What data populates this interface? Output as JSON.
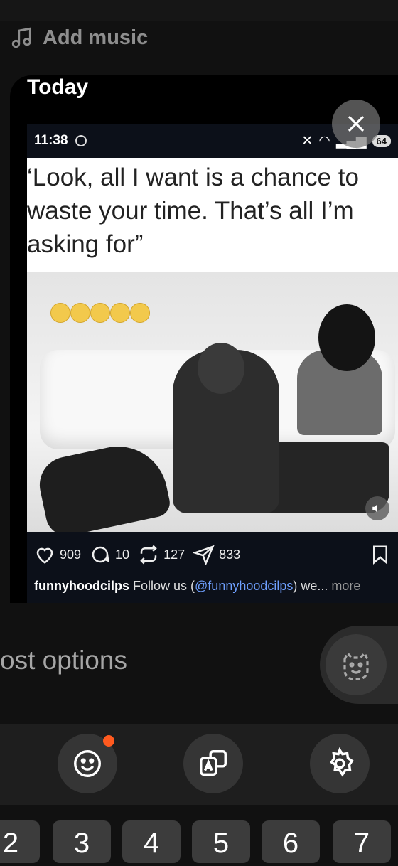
{
  "add_music": {
    "label": "Add music"
  },
  "card": {
    "title": "Today"
  },
  "screenshot": {
    "status_time": "11:38",
    "battery": "64",
    "quote": "‘Look, all I want is a chance to\nwaste your time. That’s all I’m\nasking for”",
    "likes": "909",
    "comments": "10",
    "reposts": "127",
    "shares": "833",
    "caption_user": "funnyhoodcilps",
    "caption_text": " Follow us (",
    "caption_handle": "@funnyhoodcilps",
    "caption_rest": ") we... ",
    "caption_more": "more"
  },
  "post_options": {
    "label": "ost options"
  },
  "keyboard_row": [
    "2",
    "3",
    "4",
    "5",
    "6",
    "7"
  ],
  "colors": {
    "accent_dot": "#ff5a1f",
    "link": "#6fa0ff",
    "bg": "#111111"
  }
}
